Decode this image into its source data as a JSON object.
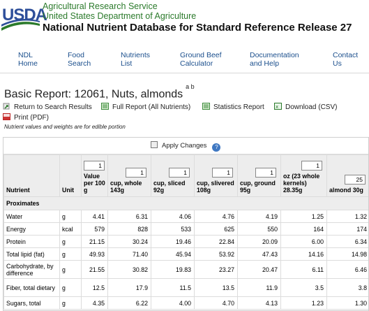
{
  "header": {
    "logo_text": "USDA",
    "agency": "Agricultural Research Service",
    "department": "United States Department of Agriculture",
    "database_title": "National Nutrient Database for Standard Reference Release 27"
  },
  "nav": [
    {
      "line1": "NDL",
      "line2": "Home"
    },
    {
      "line1": "Food",
      "line2": "Search"
    },
    {
      "line1": "Nutrients",
      "line2": "List"
    },
    {
      "line1": "Ground Beef",
      "line2": "Calculator"
    },
    {
      "line1": "Documentation",
      "line2": "and Help"
    },
    {
      "line1": "Contact",
      "line2": "Us"
    }
  ],
  "report": {
    "title": "Basic Report:  12061, Nuts, almonds",
    "footnote_marks": "a  b",
    "links": {
      "return": "Return to Search Results",
      "full": "Full Report (All Nutrients)",
      "stats": "Statistics Report",
      "download": "Download (CSV)",
      "print": "Print (PDF)"
    },
    "note": "Nutrient values and weights are for edible portion"
  },
  "table": {
    "apply_label": "Apply Changes",
    "help_label": "?",
    "col_nutrient": "Nutrient",
    "col_unit": "Unit",
    "columns": [
      {
        "qty": "1",
        "label": "Value per 100 g"
      },
      {
        "qty": "1",
        "label": "cup, whole 143g"
      },
      {
        "qty": "1",
        "label": "cup, sliced 92g"
      },
      {
        "qty": "1",
        "label": "cup, slivered 108g"
      },
      {
        "qty": "1",
        "label": "cup, ground 95g"
      },
      {
        "qty": "1",
        "label": "oz (23 whole kernels) 28.35g"
      },
      {
        "qty": "25",
        "label": "almond 30g"
      }
    ],
    "group": "Proximates",
    "rows": [
      {
        "name": "Water",
        "unit": "g",
        "values": [
          "4.41",
          "6.31",
          "4.06",
          "4.76",
          "4.19",
          "1.25",
          "1.32"
        ]
      },
      {
        "name": "Energy",
        "unit": "kcal",
        "values": [
          "579",
          "828",
          "533",
          "625",
          "550",
          "164",
          "174"
        ]
      },
      {
        "name": "Protein",
        "unit": "g",
        "values": [
          "21.15",
          "30.24",
          "19.46",
          "22.84",
          "20.09",
          "6.00",
          "6.34"
        ]
      },
      {
        "name": "Total lipid (fat)",
        "unit": "g",
        "values": [
          "49.93",
          "71.40",
          "45.94",
          "53.92",
          "47.43",
          "14.16",
          "14.98"
        ]
      },
      {
        "name": "Carbohydrate, by difference",
        "unit": "g",
        "values": [
          "21.55",
          "30.82",
          "19.83",
          "23.27",
          "20.47",
          "6.11",
          "6.46"
        ]
      },
      {
        "name": "Fiber, total dietary",
        "unit": "g",
        "values": [
          "12.5",
          "17.9",
          "11.5",
          "13.5",
          "11.9",
          "3.5",
          "3.8"
        ]
      },
      {
        "name": "Sugars, total",
        "unit": "g",
        "values": [
          "4.35",
          "6.22",
          "4.00",
          "4.70",
          "4.13",
          "1.23",
          "1.30"
        ]
      }
    ]
  },
  "colors": {
    "logo_blue": "#2e4f9a",
    "agency_green": "#2b7a2b",
    "link_blue": "#1a4e8c",
    "header_gray": "#ededed"
  }
}
